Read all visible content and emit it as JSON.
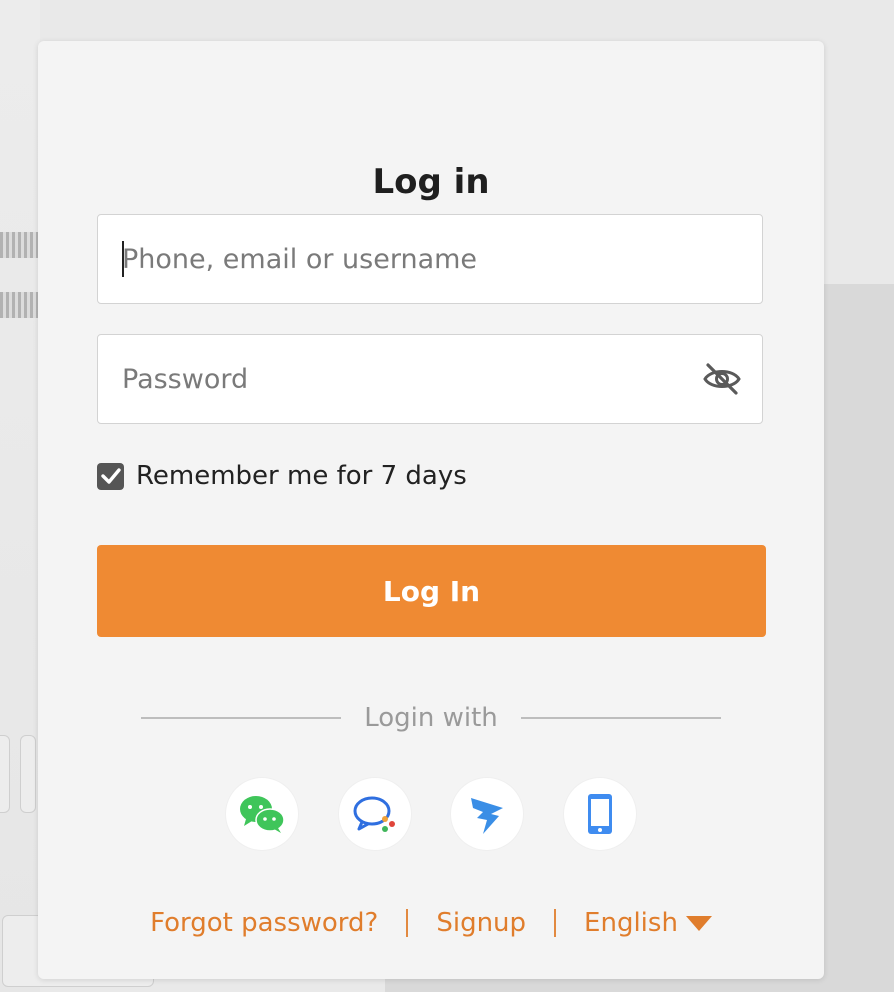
{
  "login": {
    "title": "Log in",
    "username_placeholder": "Phone, email or username",
    "username_value": "",
    "password_placeholder": "Password",
    "password_value": "",
    "remember_label": "Remember me for 7 days",
    "remember_checked": true,
    "submit_label": "Log In",
    "divider_label": "Login with",
    "social_providers": [
      {
        "name": "WeChat",
        "icon": "wechat-icon"
      },
      {
        "name": "Feishu",
        "icon": "chat-bubble-icon"
      },
      {
        "name": "DingTalk",
        "icon": "dingtalk-icon"
      },
      {
        "name": "Phone",
        "icon": "mobile-phone-icon"
      }
    ],
    "footer": {
      "forgot_label": "Forgot password?",
      "signup_label": "Signup",
      "language_label": "English"
    }
  },
  "colors": {
    "accent": "#ef8a33",
    "link": "#e07d2c",
    "modal_background": "#f4f4f4",
    "page_background": "#e9e9e9"
  }
}
